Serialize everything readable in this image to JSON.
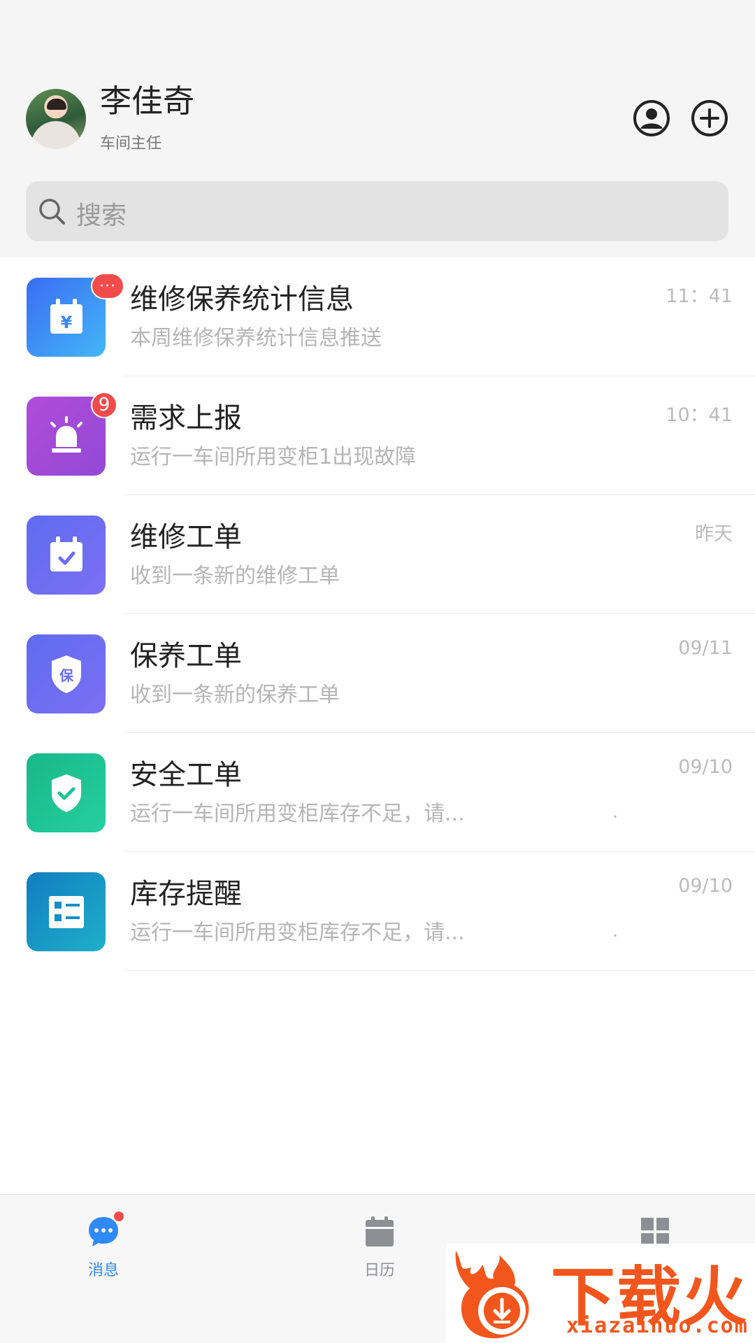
{
  "colors": {
    "accent": "#2f8af5",
    "badge": "#f24b4b",
    "watermark": "#f2561d"
  },
  "header": {
    "user_name": "李佳奇",
    "user_role": "车间主任",
    "profile_icon": "user-circle-icon",
    "add_icon": "plus-circle-icon"
  },
  "search": {
    "placeholder": "搜索"
  },
  "messages": [
    {
      "title": "维修保养统计信息",
      "subtitle": "本周维修保养统计信息推送",
      "time": "11：41",
      "badge": "···",
      "icon": "calendar-yen-icon",
      "color_from": "#3a6cf3",
      "color_to": "#43b7f7"
    },
    {
      "title": "需求上报",
      "subtitle": "运行一车间所用变柜1出现故障",
      "time": "10：41",
      "badge": "9",
      "icon": "alarm-icon",
      "color_from": "#b04cd9",
      "color_to": "#9249d6"
    },
    {
      "title": "维修工单",
      "subtitle": "收到一条新的维修工单",
      "time": "昨天",
      "badge": "",
      "icon": "calendar-check-icon",
      "color_from": "#5f6cf0",
      "color_to": "#7c6ff2"
    },
    {
      "title": "保养工单",
      "subtitle": "收到一条新的保养工单",
      "time": "09/11",
      "badge": "",
      "icon": "shield-bao-icon",
      "shield_text": "保",
      "color_from": "#5f6cf0",
      "color_to": "#7c6ff2"
    },
    {
      "title": "安全工单",
      "subtitle": "运行一车间所用变柜库存不足，请...",
      "time": "09/10",
      "badge": "",
      "trailing": ".",
      "icon": "shield-check-icon",
      "color_from": "#18b889",
      "color_to": "#26cfa0"
    },
    {
      "title": "库存提醒",
      "subtitle": "运行一车间所用变柜库存不足，请...",
      "time": "09/10",
      "badge": "",
      "trailing": ".",
      "icon": "checklist-icon",
      "color_from": "#117dc0",
      "color_to": "#1fb0c9"
    }
  ],
  "tabs": [
    {
      "label": "消息",
      "icon": "chat-bubble-icon",
      "active": true,
      "has_dot": true
    },
    {
      "label": "日历",
      "icon": "calendar-icon",
      "active": false,
      "has_dot": false
    },
    {
      "label": "",
      "icon": "grid-icon",
      "active": false,
      "has_dot": false
    }
  ],
  "watermark": {
    "title": "下载火",
    "url": "xiazaihuo.com"
  }
}
